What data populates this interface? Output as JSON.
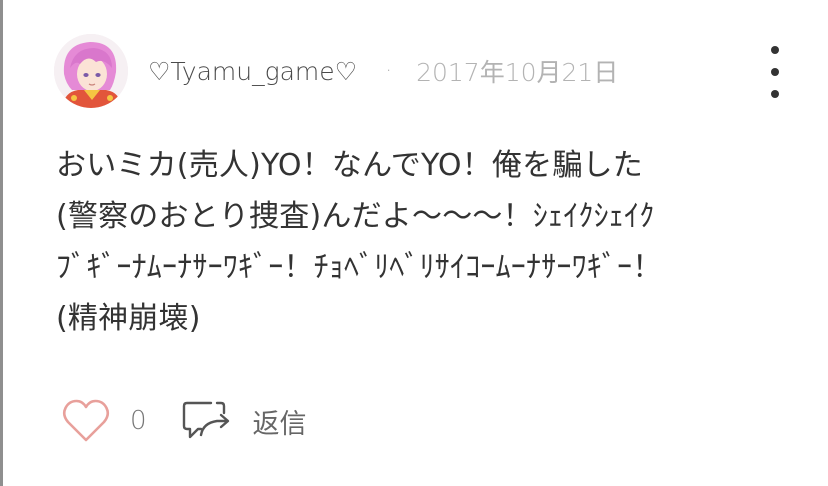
{
  "comment": {
    "author": "♡Tyamu_game♡",
    "separator": "·",
    "date": "2017年10月21日",
    "avatar_icon": "anime-character-avatar",
    "body_lines": [
      "おいミカ(売人)YO！なんでYO！俺を騙した",
      "(警察のおとり捜査)んだよ〜〜〜！ｼｪｲｸｼｪｲｸ",
      "ﾌﾞｷﾞｰﾅﾑｰﾅｻｰﾜｷﾞｰ！ﾁｮﾍﾞﾘﾍﾞﾘｻｲｺｰﾑｰﾅｻｰﾜｷﾞｰ！",
      "(精神崩壊)"
    ]
  },
  "actions": {
    "like_icon": "heart-outline-icon",
    "like_color": "#e8a09b",
    "like_count": "0",
    "reply_icon": "reply-bubble-icon",
    "reply_label": "返信"
  },
  "menu": {
    "icon": "more-vertical-icon"
  }
}
